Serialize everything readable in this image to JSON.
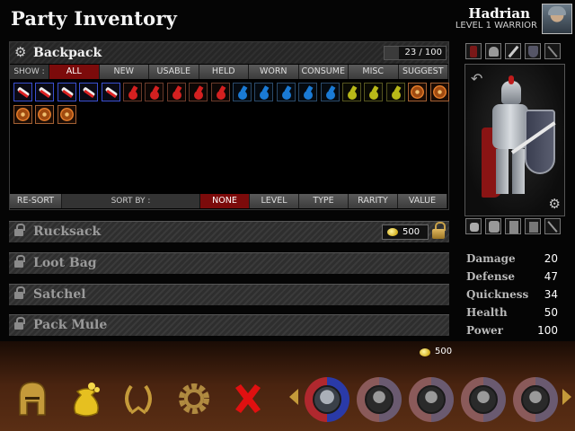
{
  "header": {
    "title": "Party Inventory"
  },
  "character": {
    "name": "Hadrian",
    "level_class": "LEVEL 1 WARRIOR"
  },
  "backpack": {
    "title": "Backpack",
    "capacity_text": "23 / 100",
    "capacity_fraction": 0.23,
    "show_label": "SHOW :",
    "filters": [
      "ALL",
      "NEW",
      "USABLE",
      "HELD",
      "WORN",
      "CONSUME",
      "MISC",
      "SUGGEST"
    ],
    "active_filter": "ALL",
    "items": [
      "scroll",
      "scroll",
      "scroll",
      "scroll",
      "scroll",
      "red-potion",
      "red-potion",
      "red-potion",
      "red-potion",
      "red-potion",
      "blue-potion",
      "blue-potion",
      "blue-potion",
      "blue-potion",
      "blue-potion",
      "yellow-potion",
      "yellow-potion",
      "yellow-potion",
      "shield",
      "shield",
      "shield",
      "shield",
      "shield"
    ],
    "resort_label": "RE-SORT",
    "sort_label": "SORT BY :",
    "sort_options": [
      "NONE",
      "LEVEL",
      "TYPE",
      "RARITY",
      "VALUE"
    ],
    "active_sort": "NONE"
  },
  "bags": [
    {
      "name": "Rucksack",
      "price": "500"
    },
    {
      "name": "Loot Bag"
    },
    {
      "name": "Satchel"
    },
    {
      "name": "Pack Mule"
    }
  ],
  "stats": [
    {
      "label": "Damage",
      "value": "20"
    },
    {
      "label": "Defense",
      "value": "47"
    },
    {
      "label": "Quickness",
      "value": "34"
    },
    {
      "label": "Health",
      "value": "50"
    },
    {
      "label": "Power",
      "value": "100"
    }
  ],
  "gold": "500",
  "icons": {
    "settings": "gear-icon",
    "rotate": "rotate-icon",
    "lock": "lock-icon",
    "coin": "coin-icon",
    "menu": [
      "helmet-icon",
      "gold-bag-icon",
      "laurel-icon",
      "cog-icon",
      "close-icon"
    ]
  },
  "colors": {
    "active_tab": "#7c0b0b",
    "stat_label": "#b9b9b9",
    "close_red": "#e01010",
    "menu_gold": "#c9a24a"
  }
}
